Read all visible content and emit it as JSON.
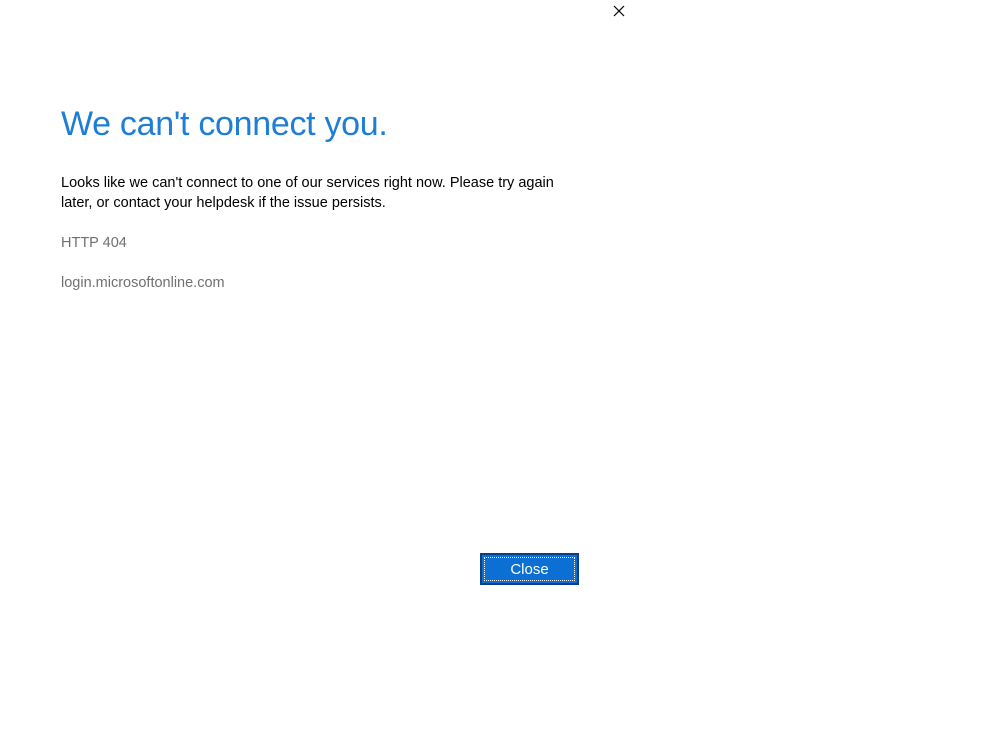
{
  "dialog": {
    "title": "We can't connect you.",
    "message": "Looks like we can't connect to one of our services right now. Please try again later, or contact your helpdesk if the issue persists.",
    "error_code": "HTTP 404",
    "host": "login.microsoftonline.com",
    "close_button_label": "Close",
    "close_icon": "close-icon"
  },
  "colors": {
    "title": "#1e7ed6",
    "secondary_text": "#707070",
    "button_background": "#0b6fd4",
    "button_border": "#0a3f86"
  }
}
